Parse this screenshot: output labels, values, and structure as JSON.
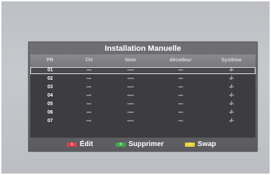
{
  "panel": {
    "title": "Installation Manuelle",
    "columns": [
      "PR",
      "CH",
      "Nom",
      "décodeur",
      "Système"
    ],
    "rows": [
      {
        "pr": "01",
        "ch": "---",
        "nom": "----",
        "dec": "---",
        "sys": "-/-",
        "selected": true
      },
      {
        "pr": "02",
        "ch": "---",
        "nom": "----",
        "dec": "---",
        "sys": "-/-",
        "selected": false
      },
      {
        "pr": "03",
        "ch": "---",
        "nom": "----",
        "dec": "---",
        "sys": "-/-",
        "selected": false
      },
      {
        "pr": "04",
        "ch": "---",
        "nom": "----",
        "dec": "---",
        "sys": "-/-",
        "selected": false
      },
      {
        "pr": "05",
        "ch": "---",
        "nom": "----",
        "dec": "---",
        "sys": "-/-",
        "selected": false
      },
      {
        "pr": "06",
        "ch": "---",
        "nom": "----",
        "dec": "---",
        "sys": "-/-",
        "selected": false
      },
      {
        "pr": "07",
        "ch": "---",
        "nom": "----",
        "dec": "---",
        "sys": "-/-",
        "selected": false
      }
    ]
  },
  "footer": {
    "edit": {
      "key": "A",
      "label": "Édit",
      "color": "#e0404a"
    },
    "delete": {
      "key": "B",
      "label": "Supprimer",
      "color": "#3fa84a"
    },
    "swap": {
      "key": "C",
      "label": "Swap",
      "color": "#e8d534"
    }
  }
}
